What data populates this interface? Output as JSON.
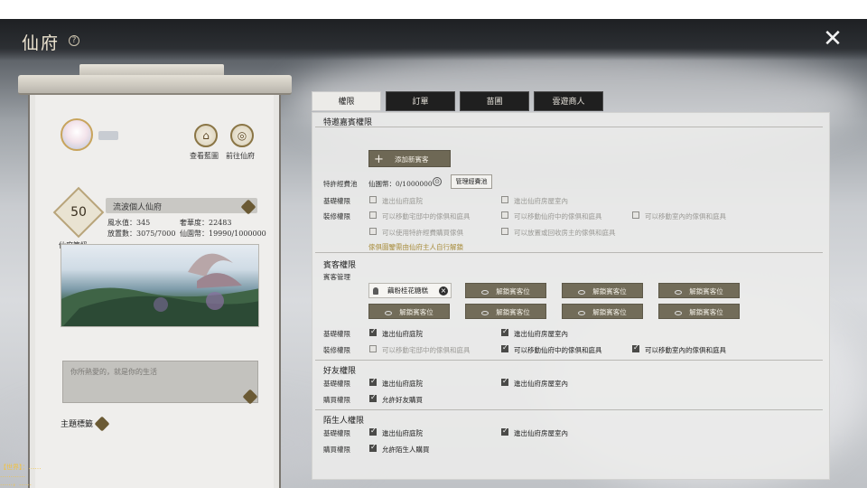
{
  "window": {
    "title": "仙府",
    "help": "?",
    "close": "✕"
  },
  "profile": {
    "actions": [
      {
        "label": "查看藍圖",
        "icon": "blueprint-icon"
      },
      {
        "label": "前往仙府",
        "icon": "travel-icon"
      }
    ],
    "level": "50",
    "level_label": "仙府等級",
    "name": "流波個人仙府",
    "stats": {
      "feng_shui_label": "風水值：",
      "feng_shui": "345",
      "luxury_label": "奢華度：",
      "luxury": "22483",
      "count_label": "放置數：",
      "count": "3075/7000",
      "coins_label": "仙園幣：",
      "coins": "19990/1000000"
    },
    "motto_placeholder": "你所熱愛的，就是你的生活",
    "theme_tags": "主題標籤"
  },
  "tabs": [
    "權限",
    "訂單",
    "苗圃",
    "雲遊商人"
  ],
  "special": {
    "title": "特邀嘉賓權限",
    "add_btn": "添加新賓客",
    "pool_label": "特許經費池",
    "coins_label": "仙園幣：",
    "coins_value": "0/1000000",
    "manage_btn": "管理經費池",
    "basic_label": "基礎權限",
    "decor_label": "裝修權限",
    "opts": {
      "enter_yard": "進出仙府庭院",
      "enter_house": "進出仙府房屋室內",
      "move_yard": "可以移動宅邸中的傢俱和庭具",
      "move_府": "可以移動仙府中的傢俱和庭具",
      "move_room": "可以移動室內的傢俱和庭具",
      "use_fund": "可以使用特許經費購買傢俱",
      "place_recycle": "可以放置或回收房主的傢俱和庭具"
    },
    "hint": "傢俱圖鑒需由仙府主人自行解鎖"
  },
  "guest": {
    "title": "賓客權限",
    "manage_label": "賓客管理",
    "first_guest": "藕粉桂花糖糕",
    "unlock": "解鎖賓客位",
    "basic_label": "基礎權限",
    "decor_label": "裝修權限",
    "opts": {
      "enter_yard": "進出仙府庭院",
      "enter_house": "進出仙府房屋室內",
      "move_yard": "可以移動宅邸中的傢俱和庭具",
      "move_府": "可以移動仙府中的傢俱和庭具",
      "move_room": "可以移動室內的傢俱和庭具"
    }
  },
  "friend": {
    "title": "好友權限",
    "basic_label": "基礎權限",
    "buy_label": "購買權限",
    "opts": {
      "enter_yard": "進出仙府庭院",
      "enter_house": "進出仙府房屋室內",
      "allow_buy": "允許好友購買"
    }
  },
  "stranger": {
    "title": "陌生人權限",
    "basic_label": "基礎權限",
    "buy_label": "購買權限",
    "opts": {
      "enter_yard": "進出仙府庭院",
      "enter_house": "進出仙府房屋室內",
      "allow_buy": "允許陌生人購買"
    }
  },
  "chat_log": [
    "【世界】：……",
    "…………",
    "……，……"
  ]
}
